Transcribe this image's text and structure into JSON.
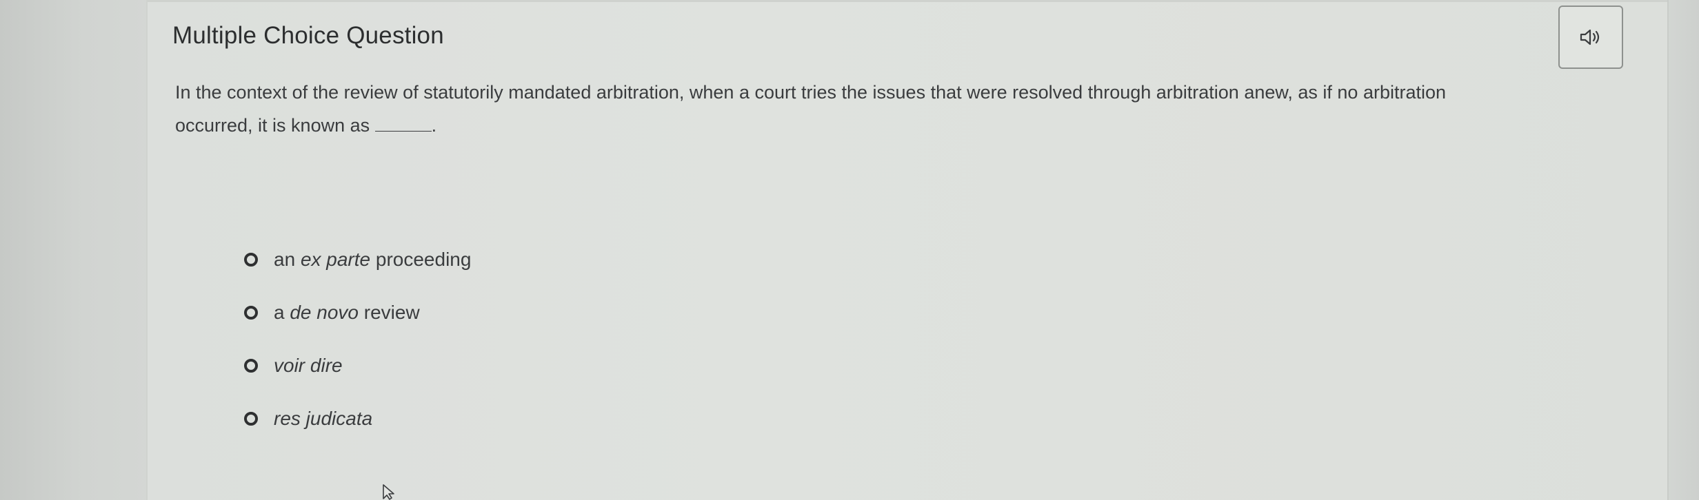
{
  "question": {
    "heading": "Multiple Choice Question",
    "prompt_line1": "In the context of the review of statutorily mandated arbitration, when a court tries the issues that were resolved through arbitration anew, as if no arbitration",
    "prompt_line2_before": "occurred, it is known as ",
    "prompt_line2_after": "."
  },
  "audio": {
    "icon": "speaker-icon"
  },
  "options": [
    {
      "prefix": "an ",
      "italic": "ex parte",
      "suffix": " proceeding"
    },
    {
      "prefix": "a ",
      "italic": "de novo",
      "suffix": " review"
    },
    {
      "prefix": "",
      "italic": "voir dire",
      "suffix": ""
    },
    {
      "prefix": "",
      "italic": "res judicata",
      "suffix": ""
    }
  ],
  "cursor": {
    "icon": "mouse-pointer-icon"
  }
}
